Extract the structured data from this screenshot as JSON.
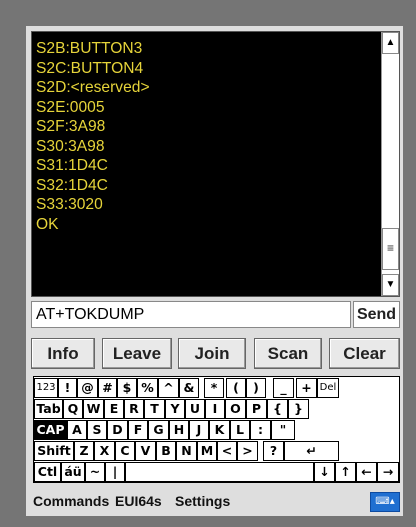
{
  "terminal": {
    "lines": [
      "S2B:BUTTON3",
      "S2C:BUTTON4",
      "S2D:<reserved>",
      "S2E:0005",
      "S2F:3A98",
      "S30:3A98",
      "S31:1D4C",
      "S32:1D4C",
      "S33:3020",
      "OK"
    ],
    "text_color": "#e6d43a",
    "background": "#000000"
  },
  "scrollbar": {
    "up_icon": "▲",
    "down_icon": "▼",
    "thumb_icon": "≡"
  },
  "command": {
    "value": "AT+TOKDUMP",
    "send_label": "Send"
  },
  "actions": [
    "Info",
    "Leave",
    "Join",
    "Scan",
    "Clear"
  ],
  "keyboard": {
    "rows": [
      [
        "123",
        "!",
        "@",
        "#",
        "$",
        "%",
        "^",
        "&",
        "*",
        "(",
        ")",
        "_",
        "+",
        "Del"
      ],
      [
        "Tab",
        "Q",
        "W",
        "E",
        "R",
        "T",
        "Y",
        "U",
        "I",
        "O",
        "P",
        "{",
        "}"
      ],
      [
        "CAP",
        "A",
        "S",
        "D",
        "F",
        "G",
        "H",
        "J",
        "K",
        "L",
        ":",
        "\""
      ],
      [
        "Shift",
        "Z",
        "X",
        "C",
        "V",
        "B",
        "N",
        "M",
        "<",
        ">",
        "?",
        "↵"
      ],
      [
        "Ctl",
        "áü",
        "~",
        "|",
        " ",
        "↓",
        "↑",
        "←",
        "→"
      ]
    ]
  },
  "menu": {
    "items": [
      "Commands",
      "EUI64s",
      "Settings"
    ],
    "keyboard_icon": "⌨▴"
  }
}
